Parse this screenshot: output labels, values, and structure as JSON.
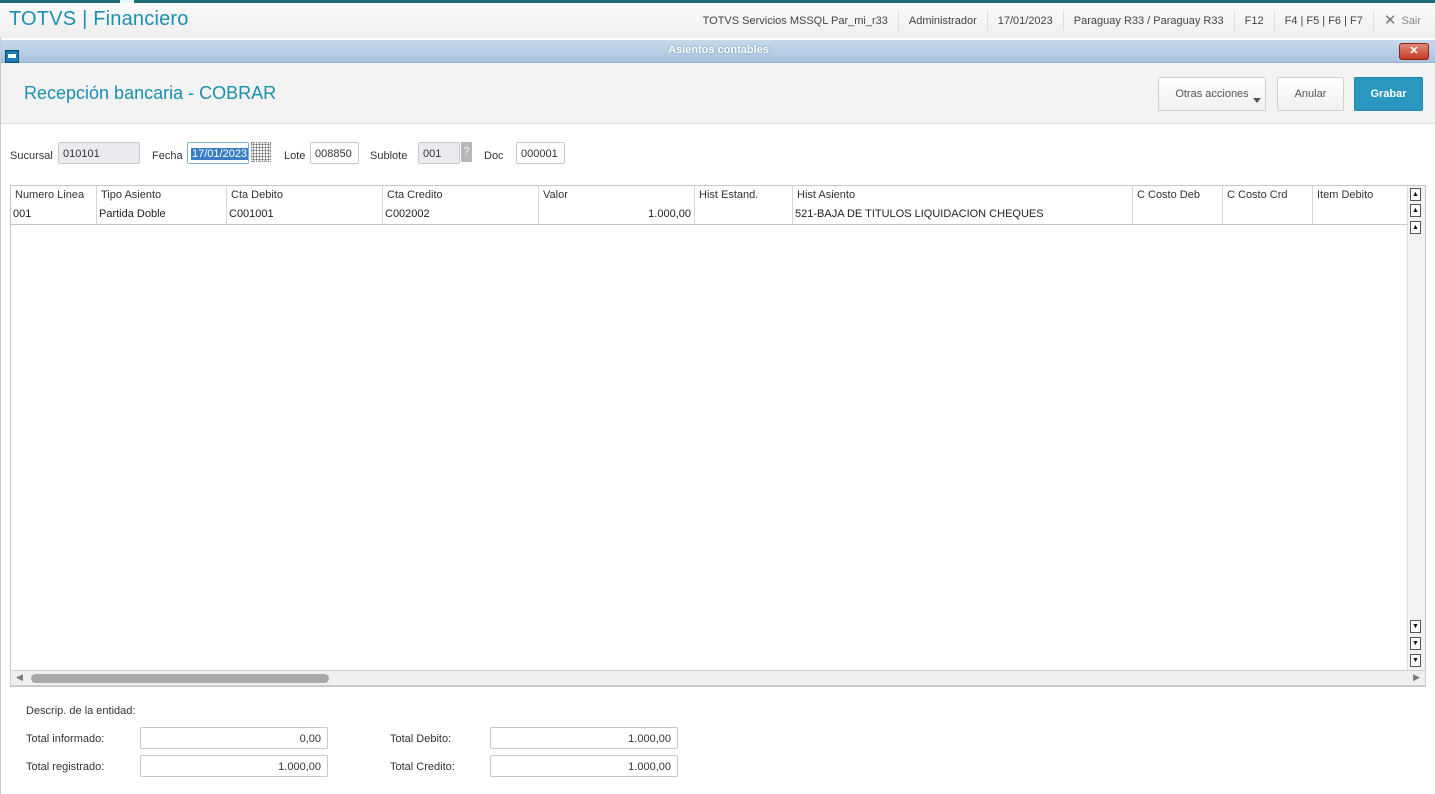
{
  "header": {
    "app_title": "TOTVS | Financiero",
    "environment": "TOTVS Servicios MSSQL Par_mi_r33",
    "user": "Administrador",
    "date": "17/01/2023",
    "company": "Paraguay R33 / Paraguay R33",
    "f12": "F12",
    "shortcuts": "F4 | F5 | F6 | F7",
    "exit_label": "Sair"
  },
  "window": {
    "title": "Asientos contables",
    "close_icon": "x-icon"
  },
  "page": {
    "title": "Recepción bancaria - COBRAR",
    "buttons": {
      "otras": "Otras acciones",
      "anular": "Anular",
      "grabar": "Grabar"
    }
  },
  "filters": {
    "sucursal_label": "Sucursal",
    "sucursal_value": "010101",
    "fecha_label": "Fecha",
    "fecha_value": "17/01/2023",
    "lote_label": "Lote",
    "lote_value": "008850",
    "sublote_label": "Sublote",
    "sublote_value": "001",
    "sublote_help": "?",
    "doc_label": "Doc",
    "doc_value": "000001"
  },
  "grid": {
    "columns": [
      "Numero Linea",
      "Tipo Asiento",
      "Cta Debito",
      "Cta Credito",
      "Valor",
      "Hist Estand.",
      "Hist Asiento",
      "C Costo Deb",
      "C Costo Crd",
      "Item Debito"
    ],
    "rows": [
      [
        "001",
        "Partida Doble",
        "C001001",
        "C002002",
        "1.000,00",
        "",
        "521-BAJA DE TITULOS LIQUIDACION CHEQUES",
        "",
        "",
        ""
      ]
    ]
  },
  "footer": {
    "entity_label": "Descrip. de la entidad:",
    "total_informado_label": "Total informado:",
    "total_informado_value": "0,00",
    "total_registrado_label": "Total registrado:",
    "total_registrado_value": "1.000,00",
    "total_debito_label": "Total Debito:",
    "total_debito_value": "1.000,00",
    "total_credito_label": "Total Credito:",
    "total_credito_value": "1.000,00"
  }
}
